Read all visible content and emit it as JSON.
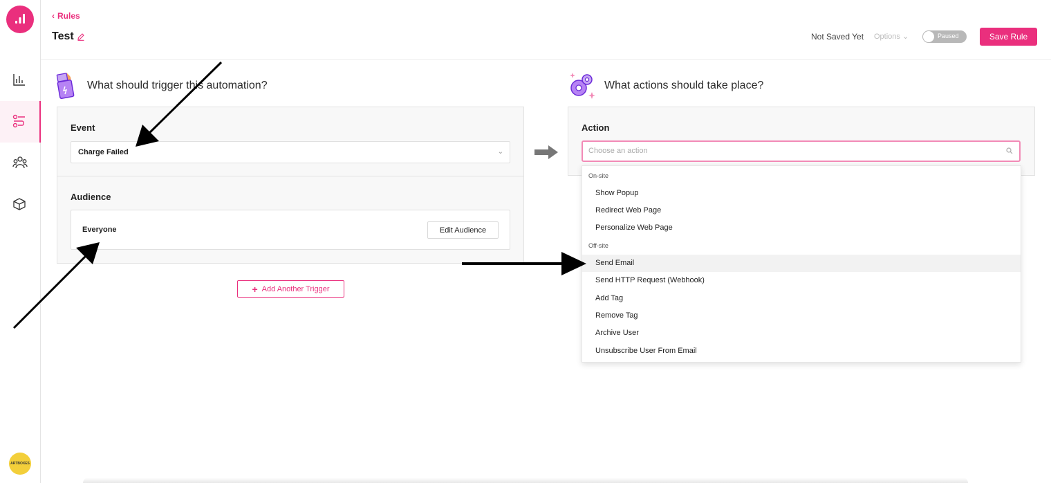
{
  "header": {
    "breadcrumb": "Rules",
    "title": "Test",
    "save_status": "Not Saved Yet",
    "options_label": "Options",
    "toggle_label": "Paused",
    "save_label": "Save Rule"
  },
  "sidebar": {
    "avatar_text": "ARTBOXES",
    "items": [
      "analytics-icon",
      "rules-icon",
      "audience-icon",
      "box-icon"
    ],
    "active": "rules-icon"
  },
  "trigger": {
    "heading": "What should trigger this automation?",
    "event_label": "Event",
    "event_value": "Charge Failed",
    "audience_label": "Audience",
    "audience_value": "Everyone",
    "edit_audience_label": "Edit Audience",
    "add_trigger_label": "Add Another Trigger"
  },
  "actions": {
    "heading": "What actions should take place?",
    "action_label": "Action",
    "placeholder": "Choose an action",
    "groups": [
      {
        "label": "On-site",
        "items": [
          "Show Popup",
          "Redirect Web Page",
          "Personalize Web Page"
        ]
      },
      {
        "label": "Off-site",
        "items": [
          "Send Email",
          "Send HTTP Request (Webhook)",
          "Add Tag",
          "Remove Tag",
          "Archive User",
          "Unsubscribe User From Email"
        ]
      }
    ],
    "highlighted_item": "Send Email"
  },
  "colors": {
    "accent": "#ea2f7d",
    "toggle_off": "#b8b8b8",
    "avatar": "#f3cf3a"
  }
}
